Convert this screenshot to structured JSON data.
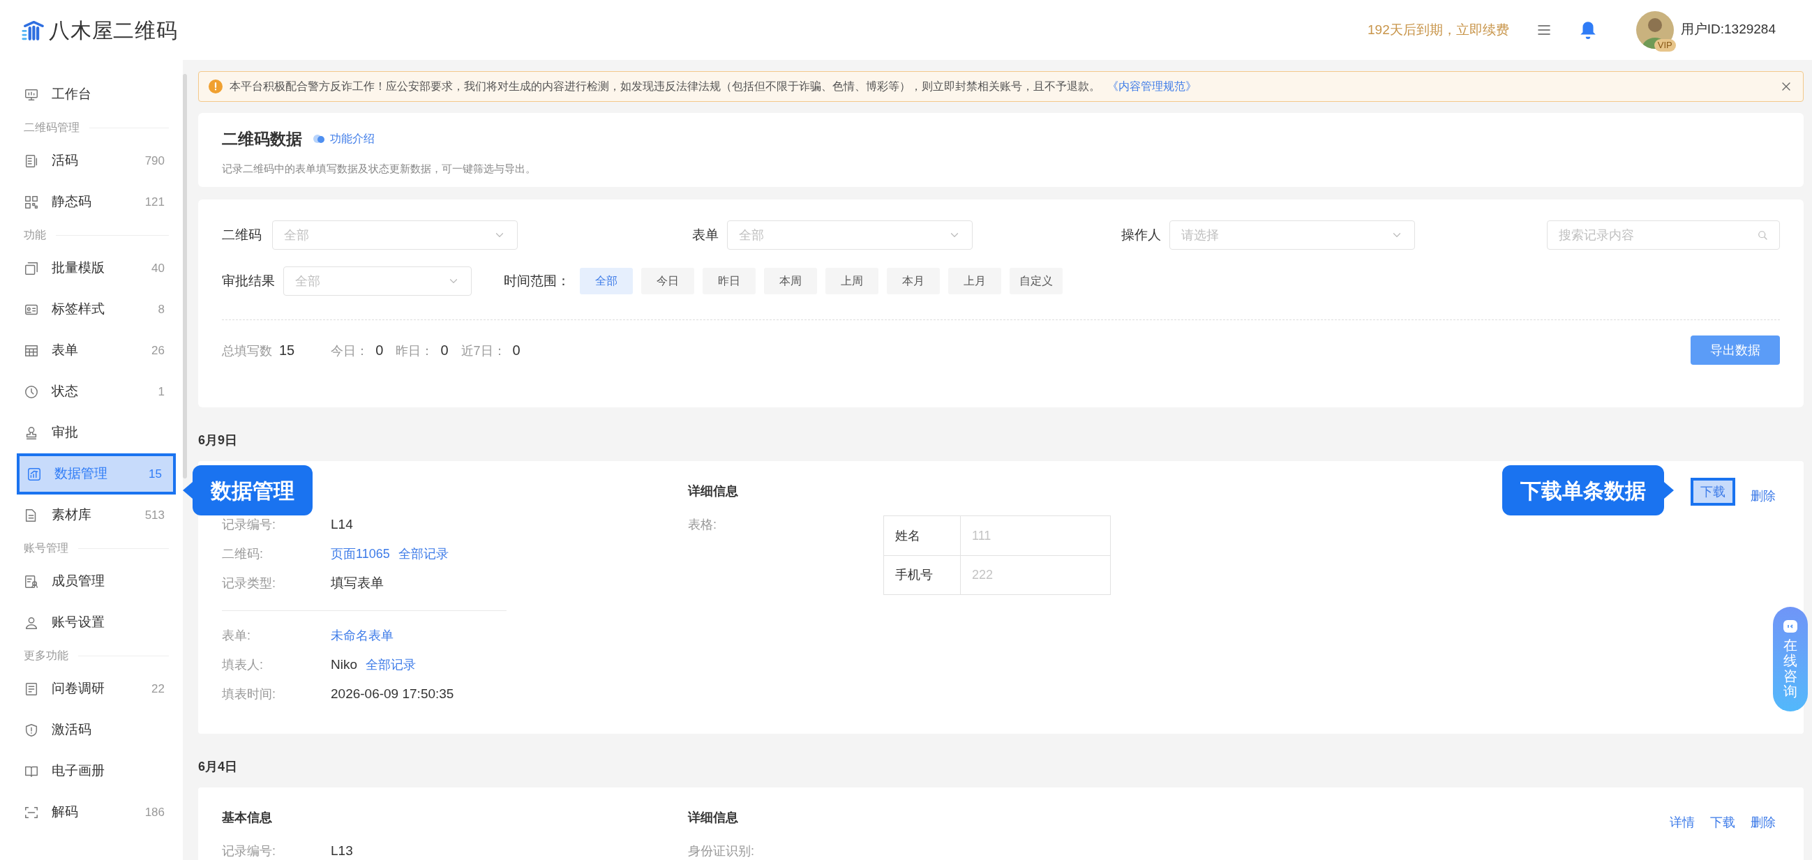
{
  "header": {
    "logo": "八木屋二维码",
    "expiry": "192天后到期，立即续费",
    "vip_badge": "VIP",
    "user_id": "用户ID:1329284"
  },
  "sidebar": {
    "items": [
      {
        "kind": "item",
        "label": "工作台",
        "selected": false
      },
      {
        "kind": "section",
        "label": "二维码管理"
      },
      {
        "kind": "item",
        "label": "活码",
        "count": "790",
        "selected": false
      },
      {
        "kind": "item",
        "label": "静态码",
        "count": "121",
        "selected": false
      },
      {
        "kind": "section",
        "label": "功能"
      },
      {
        "kind": "item",
        "label": "批量模版",
        "count": "40",
        "selected": false
      },
      {
        "kind": "item",
        "label": "标签样式",
        "count": "8",
        "selected": false
      },
      {
        "kind": "item",
        "label": "表单",
        "count": "26",
        "selected": false
      },
      {
        "kind": "item",
        "label": "状态",
        "count": "1",
        "selected": false
      },
      {
        "kind": "item",
        "label": "审批",
        "selected": false
      },
      {
        "kind": "item",
        "label": "数据管理",
        "count": "15",
        "selected": true
      },
      {
        "kind": "item",
        "label": "素材库",
        "count": "513",
        "selected": false
      },
      {
        "kind": "section",
        "label": "账号管理"
      },
      {
        "kind": "item",
        "label": "成员管理",
        "selected": false
      },
      {
        "kind": "item",
        "label": "账号设置",
        "selected": false
      },
      {
        "kind": "section",
        "label": "更多功能"
      },
      {
        "kind": "item",
        "label": "问卷调研",
        "count": "22",
        "selected": false
      },
      {
        "kind": "item",
        "label": "激活码",
        "selected": false
      },
      {
        "kind": "item",
        "label": "电子画册",
        "selected": false
      },
      {
        "kind": "item",
        "label": "解码",
        "count": "186",
        "selected": false
      }
    ]
  },
  "notice": {
    "text": "本平台积极配合警方反诈工作！应公安部要求，我们将对生成的内容进行检测，如发现违反法律法规（包括但不限于诈骗、色情、博彩等），则立即封禁相关账号，且不予退款。",
    "link": "《内容管理规范》"
  },
  "page": {
    "title": "二维码数据",
    "intro_link": "功能介绍",
    "description": "记录二维码中的表单填写数据及状态更新数据，可一键筛选与导出。"
  },
  "filters": {
    "selects": [
      {
        "label": "二维码",
        "placeholder": "全部"
      },
      {
        "label": "表单",
        "placeholder": "全部"
      },
      {
        "label": "操作人",
        "placeholder": "请选择"
      }
    ],
    "search": {
      "placeholder": "搜索记录内容"
    },
    "approval": {
      "label": "审批结果",
      "placeholder": "全部"
    },
    "time_range": {
      "label": "时间范围：",
      "options": [
        {
          "label": "全部",
          "selected": true
        },
        {
          "label": "今日",
          "selected": false
        },
        {
          "label": "昨日",
          "selected": false
        },
        {
          "label": "本周",
          "selected": false
        },
        {
          "label": "上周",
          "selected": false
        },
        {
          "label": "本月",
          "selected": false
        },
        {
          "label": "上月",
          "selected": false
        },
        {
          "label": "自定义",
          "selected": false
        }
      ]
    },
    "stats": [
      {
        "label": "总填写数",
        "value": "15"
      },
      {
        "label": "今日：",
        "value": "0"
      },
      {
        "label": "昨日：",
        "value": "0"
      },
      {
        "label": "近7日：",
        "value": "0"
      }
    ],
    "export_button": "导出数据"
  },
  "groups": [
    {
      "date": "6月9日",
      "records": [
        {
          "detail_title": "详细信息",
          "actions": [
            {
              "label": "下载",
              "highlighted": true
            },
            {
              "label": "删除",
              "highlighted": false
            }
          ],
          "field_groups": [
            [
              {
                "label": "记录编号:",
                "parts": [
                  {
                    "kind": "text",
                    "text": "L14"
                  }
                ]
              },
              {
                "label": "二维码:",
                "parts": [
                  {
                    "kind": "link",
                    "text": "页面11065"
                  },
                  {
                    "kind": "link",
                    "text": "全部记录"
                  }
                ]
              },
              {
                "label": "记录类型:",
                "parts": [
                  {
                    "kind": "text",
                    "text": "填写表单"
                  }
                ]
              }
            ],
            [
              {
                "label": "表单:",
                "parts": [
                  {
                    "kind": "link",
                    "text": "未命名表单"
                  }
                ]
              },
              {
                "label": "填表人:",
                "parts": [
                  {
                    "kind": "text",
                    "text": "Niko"
                  },
                  {
                    "kind": "link",
                    "text": "全部记录"
                  }
                ]
              },
              {
                "label": "填表时间:",
                "parts": [
                  {
                    "kind": "text",
                    "text": "2026-06-09 17:50:35"
                  }
                ]
              }
            ]
          ],
          "detail_label": "表格:",
          "table": [
            {
              "name": "姓名",
              "value": "111"
            },
            {
              "name": "手机号",
              "value": "222"
            }
          ]
        }
      ]
    },
    {
      "date": "6月4日",
      "records": [
        {
          "basic_title": "基本信息",
          "detail_title": "详细信息",
          "actions": [
            {
              "label": "详情",
              "highlighted": false
            },
            {
              "label": "下载",
              "highlighted": false
            },
            {
              "label": "删除",
              "highlighted": false
            }
          ],
          "field_groups": [
            [
              {
                "label": "记录编号:",
                "parts": [
                  {
                    "kind": "text",
                    "text": "L13"
                  }
                ]
              }
            ]
          ],
          "detail_label": "身份证识别:"
        }
      ]
    }
  ],
  "annotations": [
    {
      "kind": "sidebar",
      "text": "数据管理"
    },
    {
      "kind": "action",
      "text": "下载单条数据"
    }
  ],
  "chat_button": {
    "text": "在线咨询"
  }
}
